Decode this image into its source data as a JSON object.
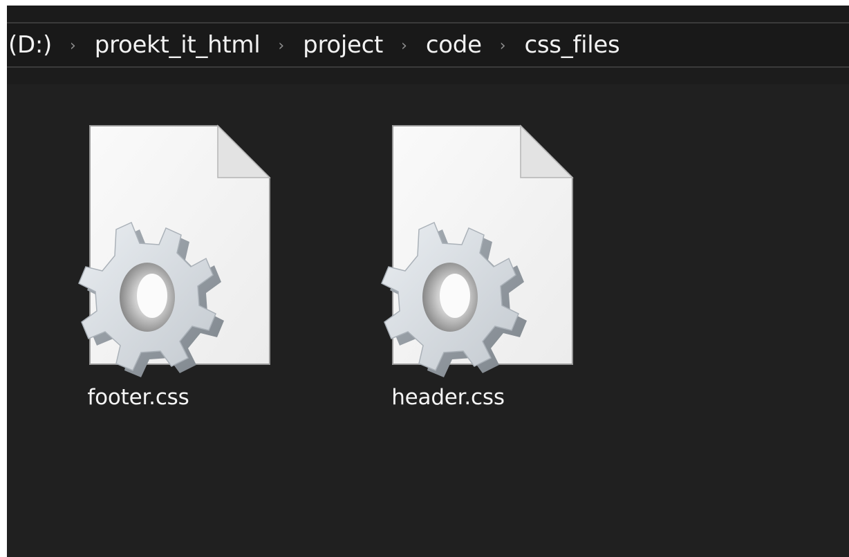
{
  "breadcrumb": {
    "items": [
      {
        "label": "(D:)"
      },
      {
        "label": "proekt_it_html"
      },
      {
        "label": "project"
      },
      {
        "label": "code"
      },
      {
        "label": "css_files"
      }
    ],
    "separator": "›"
  },
  "files": [
    {
      "name": "footer.css",
      "icon": "css-settings-file-icon"
    },
    {
      "name": "header.css",
      "icon": "css-settings-file-icon"
    }
  ],
  "colors": {
    "window_bg": "#202020",
    "address_bg": "#191919",
    "text": "#f2f2f2",
    "separator": "#8f8f8f"
  }
}
